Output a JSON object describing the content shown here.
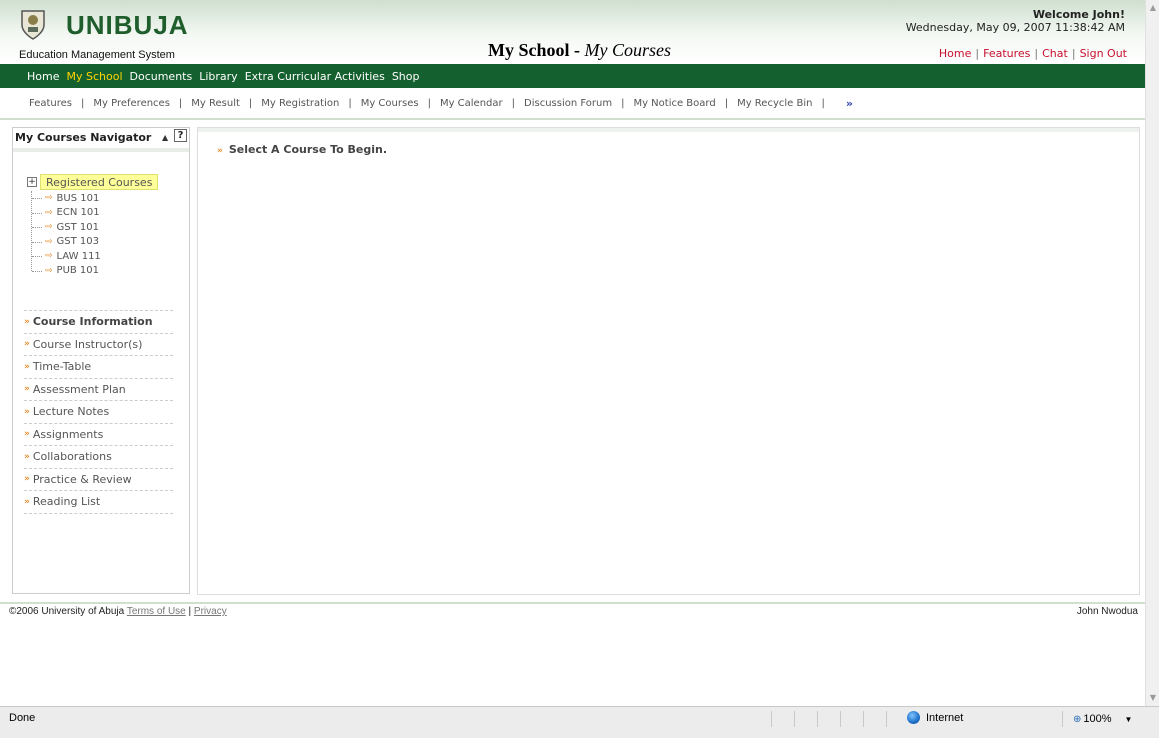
{
  "header": {
    "brand": "UNIBUJA",
    "tagline": "Education Management System",
    "title_main": "My School",
    "title_sep": " - ",
    "title_sub": "My Courses",
    "welcome": "Welcome John!",
    "datetime": "Wednesday, May 09, 2007 11:38:42 AM",
    "links": [
      "Home",
      "Features",
      "Chat",
      "Sign Out"
    ]
  },
  "mainnav": {
    "items": [
      "Home",
      "My School",
      "Documents",
      "Library",
      "Extra Curricular Activities",
      "Shop"
    ],
    "active": "My School"
  },
  "subnav": {
    "items": [
      "Features",
      "My Preferences",
      "My Result",
      "My Registration",
      "My Courses",
      "My Calendar",
      "Discussion Forum",
      "My Notice Board",
      "My Recycle Bin"
    ],
    "separator": "|",
    "more": "»"
  },
  "navigator": {
    "title": "My Courses Navigator",
    "collapse": "▲",
    "help": "?",
    "tree_toggle": "+",
    "tree_root": "Registered Courses",
    "courses": [
      "BUS 101",
      "ECN 101",
      "GST 101",
      "GST 103",
      "LAW 111",
      "PUB 101"
    ],
    "course_arrow": "⇨",
    "info_items": [
      "Course Information",
      "Course Instructor(s)",
      "Time-Table",
      "Assessment Plan",
      "Lecture Notes",
      "Assignments",
      "Collaborations",
      "Practice & Review",
      "Reading List"
    ],
    "bullet": "»"
  },
  "content": {
    "prompt": "Select A Course To Begin.",
    "bullet": "»"
  },
  "footer": {
    "copyright": "©2006 University of Abuja",
    "terms": "Terms of Use",
    "sep": "|",
    "privacy": "Privacy",
    "user": "John Nwodua"
  },
  "statusbar": {
    "status": "Done",
    "zone": "Internet",
    "zoom": "100%",
    "zoom_icon": "⊕",
    "caret": "▼",
    "scroll_up": "▲",
    "scroll_down": "▼"
  },
  "colors": {
    "nav_green": "#15602f",
    "active_yellow": "#ffd400",
    "link_red": "#c8102e",
    "highlight": "#ffff99",
    "accent_orange": "#e08a2a"
  }
}
